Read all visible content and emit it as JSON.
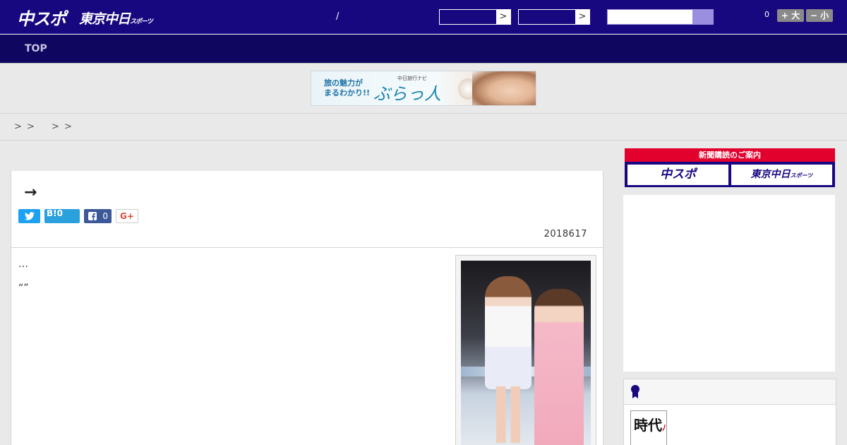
{
  "header": {
    "logo_chunichi": "中スポ",
    "logo_tokyo": "東京中日",
    "logo_tokyo_sub": "スポーツ",
    "slash": "/",
    "select1_arrow": ">",
    "select2_arrow": ">",
    "search_placeholder": "",
    "font_count": "0",
    "font_up": "+ 大",
    "font_down": "− 小"
  },
  "nav": {
    "top": "TOP"
  },
  "banner": {
    "text_line1": "旅の魅力が",
    "text_line2": "まるわかり!!",
    "small_label": "中日旅行ナビ",
    "brand": "ぶらっ人"
  },
  "breadcrumb": {
    "sep1": ">",
    "sep2": ">",
    "sep3": ">",
    "sep4": ">"
  },
  "article": {
    "headline": "→",
    "share": {
      "twitter_icon": "twitter-icon",
      "hatena": "B!",
      "hatena_count": "0",
      "facebook_count": "0",
      "gplus": "G+"
    },
    "date": "2018617",
    "para1": "…",
    "para2": "“”"
  },
  "sidebar": {
    "subscription_head": "新聞購読のご案内",
    "sub_btn1": "中スポ",
    "sub_btn2": "東京中日",
    "sub_btn2_sub": "スポーツ",
    "thumb_text": "時代",
    "thumb_mark": "ﾉ"
  },
  "colors": {
    "header_bg": "#180880",
    "nav_bg": "#0f0660",
    "accent_red": "#e50012",
    "accent_purple": "#6d5fba"
  }
}
